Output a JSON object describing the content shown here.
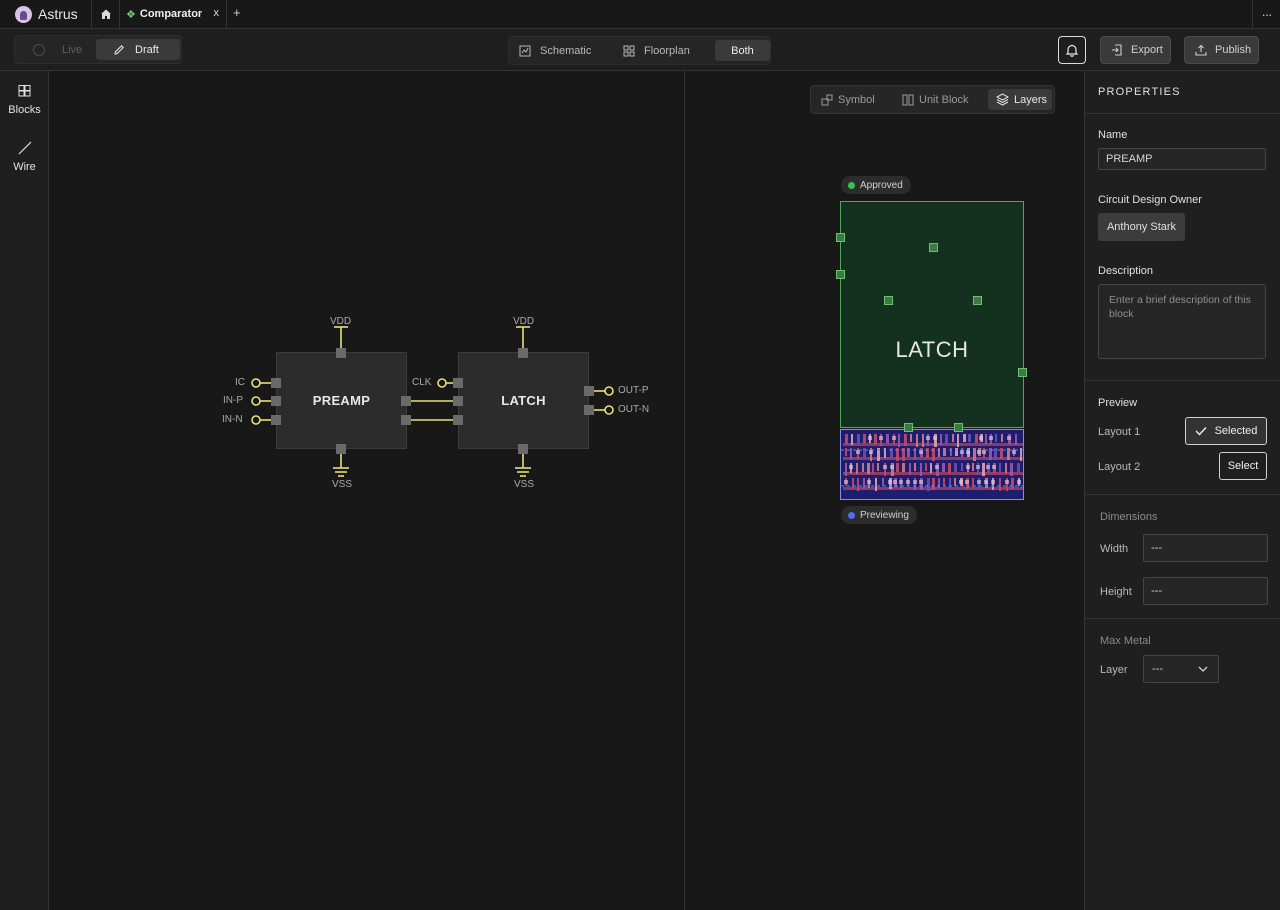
{
  "app": {
    "name": "Astrus"
  },
  "tabs": {
    "doc_title": "Comparator",
    "close": "x",
    "add": "+",
    "more": "···"
  },
  "toolbar": {
    "live_label": "Live",
    "draft_label": "Draft",
    "views": {
      "schematic": "Schematic",
      "floorplan": "Floorplan",
      "both": "Both",
      "selected": "Both"
    },
    "export_label": "Export",
    "publish_label": "Publish"
  },
  "left_rail": {
    "blocks_label": "Blocks",
    "wire_label": "Wire"
  },
  "schematic": {
    "blocks": [
      {
        "name": "PREAMP",
        "supply": "VDD",
        "ground": "VSS",
        "inputs": [
          "IC",
          "IN-P",
          "IN-N"
        ]
      },
      {
        "name": "LATCH",
        "supply": "VDD",
        "ground": "VSS",
        "inputs": [
          "CLK"
        ],
        "outputs": [
          "OUT-P",
          "OUT-N"
        ]
      }
    ],
    "wire_color": "#e8e07a"
  },
  "layout_view": {
    "tabs": {
      "symbol": "Symbol",
      "unit_block": "Unit Block",
      "layers": "Layers",
      "selected": "Layers"
    },
    "approved_label": "Approved",
    "block_label": "LATCH",
    "previewing_label": "Previewing",
    "colors": {
      "approved_dot": "#3fbf4f",
      "previewing_dot": "#4f6ff0",
      "region_border": "#4fa85c"
    }
  },
  "properties": {
    "title": "PROPERTIES",
    "name_label": "Name",
    "name_value": "PREAMP",
    "owner_label": "Circuit Design Owner",
    "owner_value": "Anthony Stark",
    "description_label": "Description",
    "description_placeholder": "Enter a brief description of this block",
    "preview_label": "Preview",
    "layout1_label": "Layout 1",
    "layout1_button": "Selected",
    "layout2_label": "Layout 2",
    "layout2_button": "Select",
    "dimensions_label": "Dimensions",
    "width_label": "Width",
    "width_value": "---",
    "height_label": "Height",
    "height_value": "---",
    "max_metal_label": "Max Metal",
    "layer_label": "Layer",
    "layer_value": "---"
  }
}
